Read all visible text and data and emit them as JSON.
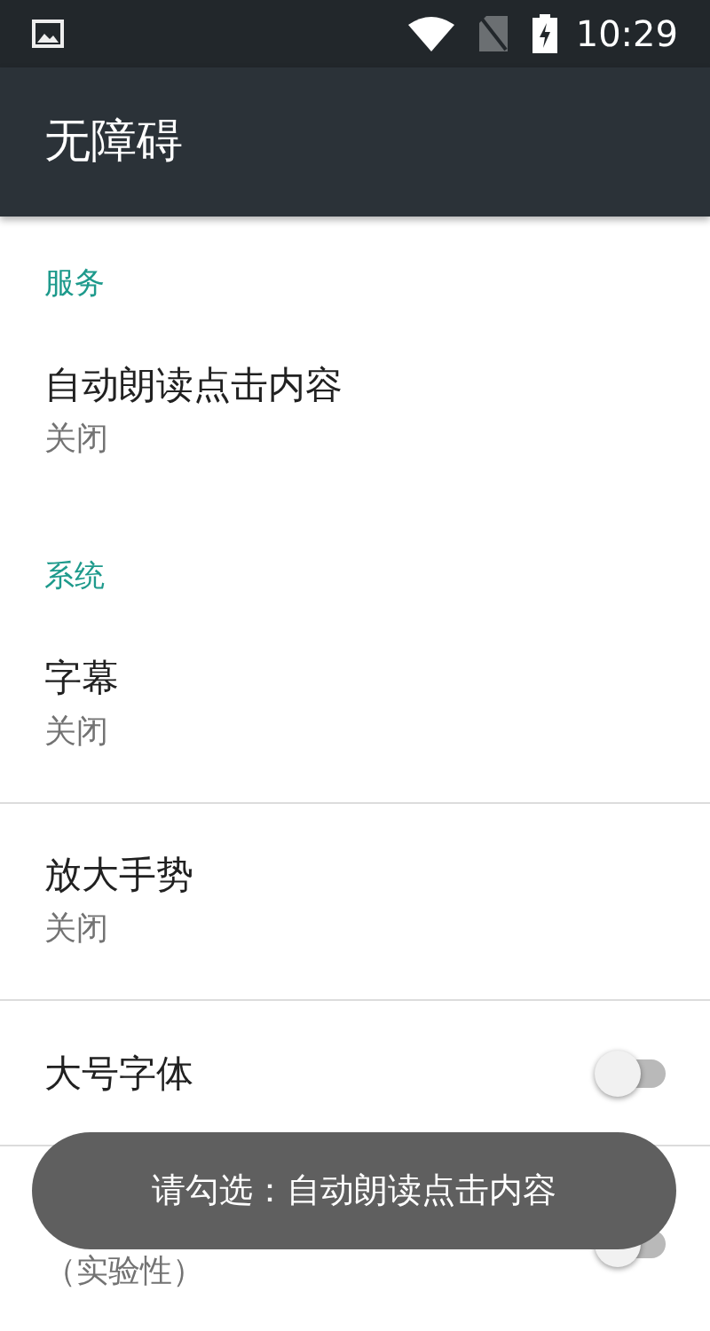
{
  "status_bar": {
    "time": "10:29"
  },
  "toolbar": {
    "title": "无障碍"
  },
  "sections": [
    {
      "header": "服务",
      "items": [
        {
          "kind": "summary",
          "title": "自动朗读点击内容",
          "summary": "关闭"
        }
      ]
    },
    {
      "header": "系统",
      "items": [
        {
          "kind": "summary",
          "title": "字幕",
          "summary": "关闭"
        },
        {
          "kind": "summary",
          "title": "放大手势",
          "summary": "关闭"
        },
        {
          "kind": "switch",
          "title": "大号字体",
          "on": false
        },
        {
          "kind": "switch",
          "summary": "（实验性）",
          "on": false
        }
      ]
    }
  ],
  "toast": {
    "text": "请勾选：自动朗读点击内容"
  }
}
